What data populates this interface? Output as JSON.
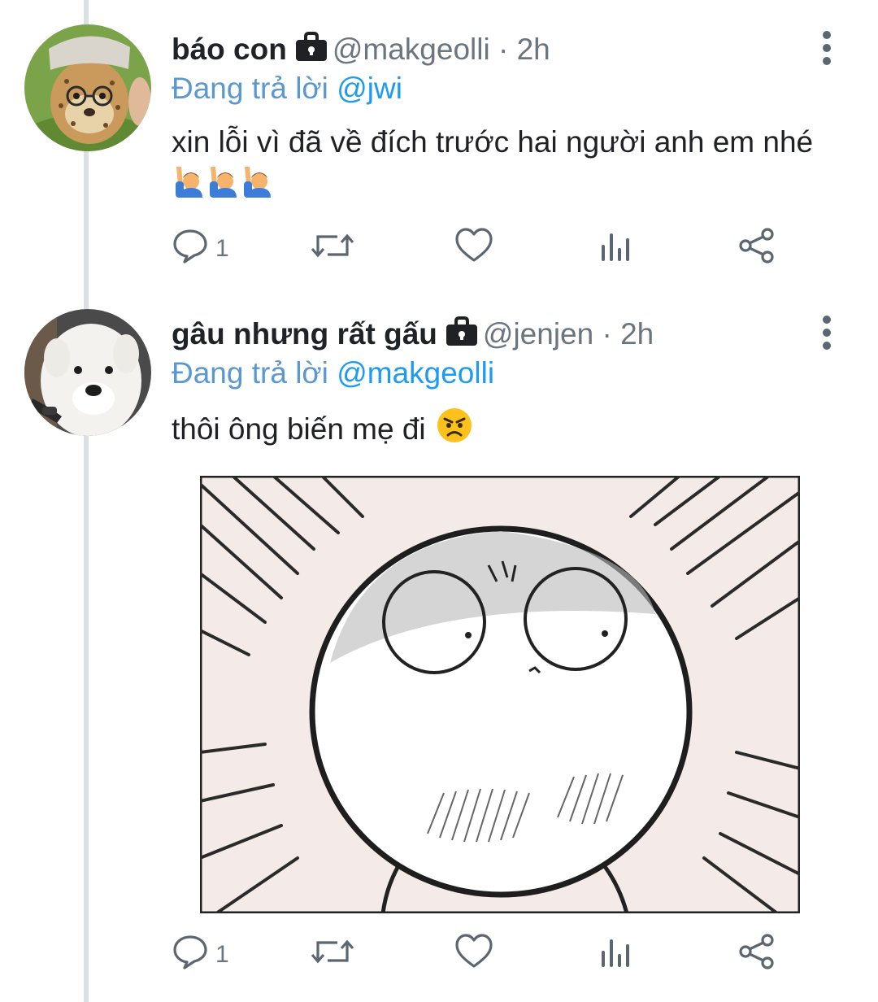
{
  "tweets": [
    {
      "display_name": "báo con",
      "handle": "@makgeolli",
      "separator": "·",
      "time": "2h",
      "reply_prefix": "Đang trả lời",
      "reply_to": "@jwi",
      "text": "xin lỗi vì đã về đích trước hai người anh em nhé",
      "emojis": [
        "person-raising-hand",
        "person-raising-hand",
        "person-raising-hand"
      ],
      "avatar": "cheetah-cub-photo",
      "actions": {
        "reply_count": "1",
        "retweet_count": "",
        "like_count": ""
      }
    },
    {
      "display_name": "gâu nhưng rất gấu",
      "handle": "@jenjen",
      "separator": "·",
      "time": "2h",
      "reply_prefix": "Đang trả lời",
      "reply_to": "@makgeolli",
      "text": "thôi ông biến mẹ đi",
      "emojis": [
        "angry-face"
      ],
      "avatar": "samoyed-dog-photo",
      "media": "cartoon-shocked-face-image",
      "actions": {
        "reply_count": "1",
        "retweet_count": "",
        "like_count": ""
      }
    }
  ],
  "colors": {
    "mention": "#1d9bf0",
    "meta": "#6b7580",
    "thread_line": "#dcdfe3",
    "icon": "#5b6670"
  }
}
